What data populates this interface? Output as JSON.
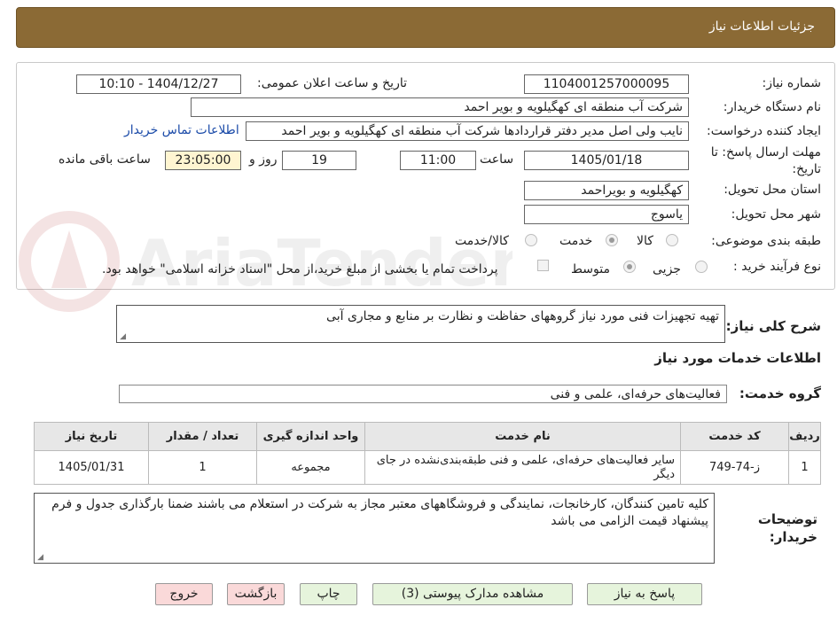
{
  "header": {
    "title": "جزئیات اطلاعات نیاز"
  },
  "form": {
    "need_number_label": "شماره نیاز:",
    "need_number": "1104001257000095",
    "announce_label": "تاریخ و ساعت اعلان عمومی:",
    "announce_value": "1404/12/27 - 10:10",
    "buyer_org_label": "نام دستگاه خریدار:",
    "buyer_org": "شرکت آب منطقه ای کهگیلویه و بویر احمد",
    "requester_label": "ایجاد کننده درخواست:",
    "requester": "نایب ولی اصل مدیر دفتر قراردادها شرکت آب منطقه ای کهگیلویه و بویر احمد",
    "contact_link": "اطلاعات تماس خریدار",
    "deadline_label": "مهلت ارسال پاسخ: تا تاریخ:",
    "deadline_date": "1405/01/18",
    "time_label": "ساعت",
    "deadline_time": "11:00",
    "days": "19",
    "days_label": "روز و",
    "remaining_time": "23:05:00",
    "remaining_label": "ساعت باقی مانده",
    "province_label": "استان محل تحویل:",
    "province": "کهگیلویه و بویراحمد",
    "city_label": "شهر محل تحویل:",
    "city": "یاسوج",
    "category_label": "طبقه بندی موضوعی:",
    "category_options": [
      "کالا",
      "خدمت",
      "کالا/خدمت"
    ],
    "category_selected": "خدمت",
    "process_label": "نوع فرآیند خرید :",
    "process_options": [
      "جزیی",
      "متوسط"
    ],
    "process_selected": "متوسط",
    "payment_note": "پرداخت تمام یا بخشی از مبلغ خرید،از محل \"اسناد خزانه اسلامی\" خواهد بود."
  },
  "description": {
    "label": "شرح کلی نیاز:",
    "value": "تهیه تجهیزات فنی مورد نیاز گروههای حفاظت و نظارت بر منابع و مجاری آبی"
  },
  "services": {
    "section_title": "اطلاعات خدمات مورد نیاز",
    "group_label": "گروه خدمت:",
    "group_value": "فعالیت‌های حرفه‌ای، علمی و فنی",
    "columns": [
      "ردیف",
      "کد خدمت",
      "نام خدمت",
      "واحد اندازه گیری",
      "تعداد / مقدار",
      "تاریخ نیاز"
    ],
    "rows": [
      {
        "row": "1",
        "code": "ز-74-749",
        "name": "سایر فعالیت‌های حرفه‌ای، علمی و فنی طبقه‌بندی‌نشده در جای دیگر",
        "unit": "مجموعه",
        "qty": "1",
        "date": "1405/01/31"
      }
    ]
  },
  "buyer_notes": {
    "label": "توضیحات خریدار:",
    "value": "کلیه تامین کنندگان، کارخانجات، نمایندگی و فروشگاههای معتبر مجاز به شرکت در استعلام می باشند ضمنا بارگذاری جدول و فرم پیشنهاد قیمت الزامی می باشد"
  },
  "buttons": {
    "reply": "پاسخ به نیاز",
    "attachments": "مشاهده مدارک پیوستی (3)",
    "print": "چاپ",
    "back": "بازگشت",
    "exit": "خروج"
  },
  "watermark": {
    "text": "AriaTender.neT"
  },
  "colors": {
    "header_bg": "#8b6a35",
    "highlight": "#fff5d1",
    "link": "#1a4aa8",
    "button_green": "#e6f4dc",
    "button_pink": "#fad9d9"
  }
}
